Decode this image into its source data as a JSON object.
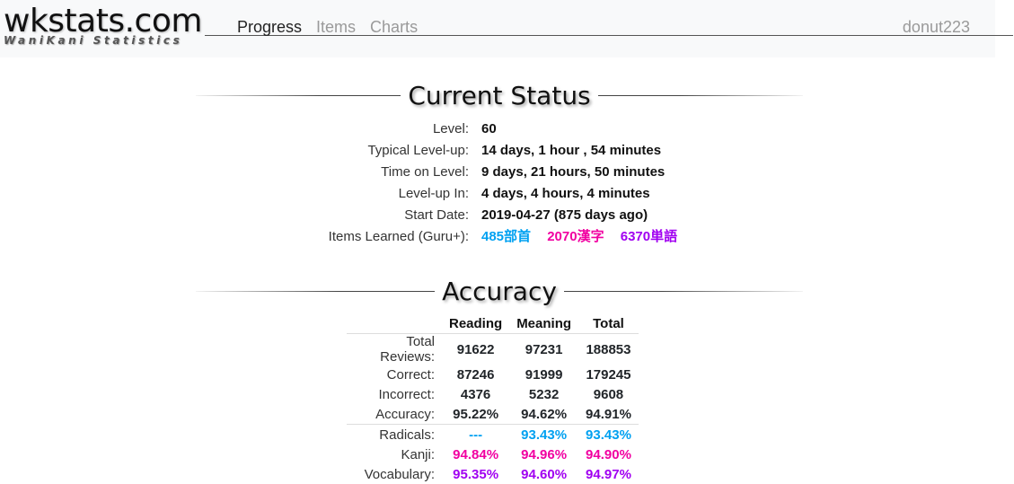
{
  "brand": {
    "title": "wkstats.com",
    "subtitle": "WaniKani Statistics"
  },
  "nav": {
    "links": [
      "Progress",
      "Items",
      "Charts"
    ],
    "active": "Progress",
    "user": "donut223"
  },
  "current_status": {
    "heading": "Current Status",
    "rows": [
      {
        "label": "Level:",
        "value": "60"
      },
      {
        "label": "Typical Level-up:",
        "value": "14 days, 1 hour , 54 minutes"
      },
      {
        "label": "Time on Level:",
        "value": "9 days, 21 hours, 50 minutes"
      },
      {
        "label": "Level-up In:",
        "value": "4 days, 4 hours, 4 minutes"
      },
      {
        "label": "Start Date:",
        "value": "2019-04-27 (875 days ago)"
      }
    ],
    "items_learned": {
      "label": "Items Learned (Guru+):",
      "radicals": "485部首",
      "kanji": "2070漢字",
      "vocabulary": "6370単語"
    }
  },
  "colors": {
    "radicals": "#00a1f1",
    "kanji": "#f100a1",
    "vocabulary": "#a100f1"
  },
  "accuracy": {
    "heading": "Accuracy",
    "columns": [
      "Reading",
      "Meaning",
      "Total"
    ],
    "rows": [
      {
        "label": "Total Reviews:",
        "values": [
          "91622",
          "97231",
          "188853"
        ]
      },
      {
        "label": "Correct:",
        "values": [
          "87246",
          "91999",
          "179245"
        ]
      },
      {
        "label": "Incorrect:",
        "values": [
          "4376",
          "5232",
          "9608"
        ]
      },
      {
        "label": "Accuracy:",
        "values": [
          "95.22%",
          "94.62%",
          "94.91%"
        ]
      },
      {
        "label": "Radicals:",
        "values": [
          "---",
          "93.43%",
          "93.43%"
        ]
      },
      {
        "label": "Kanji:",
        "values": [
          "94.84%",
          "94.96%",
          "94.90%"
        ]
      },
      {
        "label": "Vocabulary:",
        "values": [
          "95.35%",
          "94.60%",
          "94.97%"
        ]
      }
    ]
  }
}
